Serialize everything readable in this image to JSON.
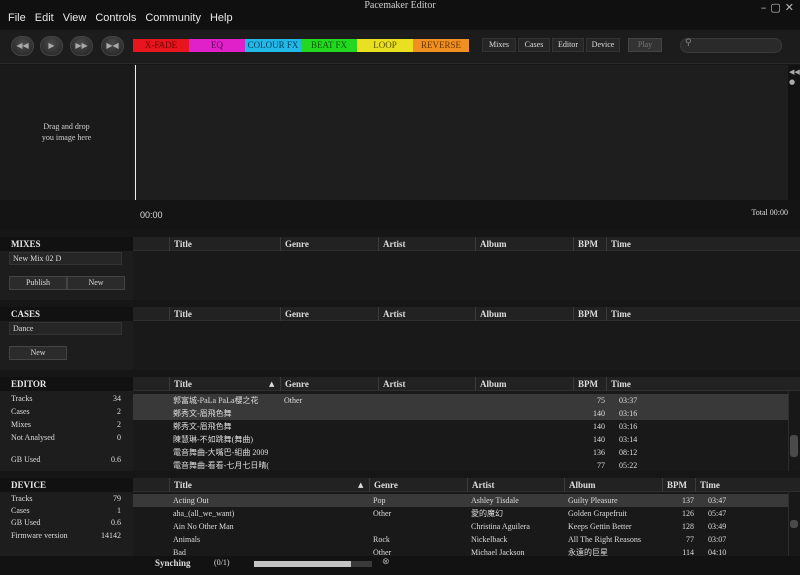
{
  "app": {
    "title": "Pacemaker Editor"
  },
  "menu": [
    "File",
    "Edit",
    "View",
    "Controls",
    "Community",
    "Help"
  ],
  "window_controls": [
    "–",
    "▢",
    "✕"
  ],
  "transport": [
    "◀◀",
    "▶",
    "▶▶",
    "▶◀"
  ],
  "fx": [
    {
      "label": "X-FADE",
      "color": "#e8141e",
      "text": "#6a0000",
      "w": 56
    },
    {
      "label": "EQ",
      "color": "#e020c8",
      "text": "#5a0050",
      "w": 56
    },
    {
      "label": "COLOUR FX",
      "color": "#22b8e8",
      "text": "#00405a",
      "w": 56
    },
    {
      "label": "BEAT FX",
      "color": "#22d820",
      "text": "#0a5a00",
      "w": 56
    },
    {
      "label": "LOOP",
      "color": "#e8e020",
      "text": "#5a5200",
      "w": 56
    },
    {
      "label": "REVERSE",
      "color": "#f09020",
      "text": "#6a3200",
      "w": 56
    }
  ],
  "views": [
    "Mixes",
    "Cases",
    "Editor",
    "Device"
  ],
  "play": "Play",
  "search": {
    "value": ""
  },
  "image_drop": {
    "line1": "Drag and drop",
    "line2": "you image here"
  },
  "timeline": {
    "start": "00:00",
    "total": "Total 00:00"
  },
  "columns": [
    "Title",
    "Genre",
    "Artist",
    "Album",
    "BPM",
    "Time"
  ],
  "mixes": {
    "heading": "MIXES",
    "selected": "New Mix 02 D",
    "publish": "Publish",
    "new": "New"
  },
  "cases": {
    "heading": "CASES",
    "selected": "Dance",
    "new": "New"
  },
  "editor": {
    "heading": "EDITOR",
    "stats": [
      {
        "label": "Tracks",
        "value": "34"
      },
      {
        "label": "Cases",
        "value": "2"
      },
      {
        "label": "Mixes",
        "value": "2"
      },
      {
        "label": "Not Analysed",
        "value": "0"
      }
    ],
    "gb_used": {
      "label": "GB Used",
      "value": "0.6"
    },
    "tracks": [
      {
        "title": "郭富城-PaLa PaLa櫻之花",
        "genre": "Other",
        "artist": "",
        "album": "",
        "bpm": "75",
        "time": "03:37"
      },
      {
        "title": "鄭秀文-眉飛色舞",
        "genre": "",
        "artist": "",
        "album": "",
        "bpm": "140",
        "time": "03:16"
      },
      {
        "title": "鄭秀文-眉飛色舞",
        "genre": "",
        "artist": "",
        "album": "",
        "bpm": "140",
        "time": "03:16"
      },
      {
        "title": "陳慧琳-不如跳舞(舞曲)",
        "genre": "",
        "artist": "",
        "album": "",
        "bpm": "140",
        "time": "03:14"
      },
      {
        "title": "電音舞曲-大嘴巴-組曲 2009",
        "genre": "",
        "artist": "",
        "album": "",
        "bpm": "136",
        "time": "08:12"
      },
      {
        "title": "電音舞曲-看看-七月七日晴(",
        "genre": "",
        "artist": "",
        "album": "",
        "bpm": "77",
        "time": "05:22"
      }
    ]
  },
  "device": {
    "heading": "DEVICE",
    "stats": [
      {
        "label": "Tracks",
        "value": "79"
      },
      {
        "label": "Cases",
        "value": "1"
      }
    ],
    "gb_used": {
      "label": "GB Used",
      "value": "0.6"
    },
    "firmware": {
      "label": "Firmware version",
      "value": "14142"
    },
    "tracks": [
      {
        "title": "Acting Out",
        "genre": "Pop",
        "artist": "Ashley Tisdale",
        "album": "Guilty Pleasure",
        "bpm": "137",
        "time": "03:47"
      },
      {
        "title": "aha_(all_we_want)",
        "genre": "Other",
        "artist": "愛的魔幻",
        "album": "Golden Grapefruit",
        "bpm": "126",
        "time": "05:47"
      },
      {
        "title": "Ain    No Other Man",
        "genre": "",
        "artist": "Christina Aguilera",
        "album": "Keeps Gettin Better",
        "bpm": "128",
        "time": "03:49"
      },
      {
        "title": "Animals",
        "genre": "Rock",
        "artist": "Nickelback",
        "album": "All The Right Reasons",
        "bpm": "77",
        "time": "03:07"
      },
      {
        "title": "Bad",
        "genre": "Other",
        "artist": "Michael Jackson",
        "album": "永遠的巨星",
        "bpm": "114",
        "time": "04:10"
      }
    ]
  },
  "status": {
    "label": "Synching",
    "count": "(0/1)",
    "progress": 0.82,
    "cancel": "⊗"
  }
}
